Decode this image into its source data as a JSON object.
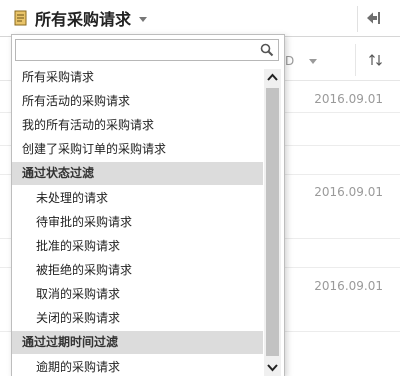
{
  "header": {
    "title": "所有采购请求",
    "icons": {
      "document": "document-icon",
      "back": "back-arrow-icon",
      "caret": "chevron-down-icon"
    }
  },
  "background": {
    "column_header": "D",
    "sort_icon": "sort-updown-icon",
    "rows": [
      {
        "date": "2016.09.01"
      },
      {
        "date": "2016.09.01"
      },
      {
        "date": "2016.09.01"
      }
    ]
  },
  "dropdown": {
    "search_value": "",
    "search_icon": "search-icon",
    "items": [
      {
        "label": "所有采购请求"
      },
      {
        "label": "所有活动的采购请求"
      },
      {
        "label": "我的所有活动的采购请求"
      },
      {
        "label": "创建了采购订单的采购请求"
      }
    ],
    "groups": [
      {
        "title": "通过状态过滤",
        "items": [
          {
            "label": "未处理的请求"
          },
          {
            "label": "待审批的采购请求"
          },
          {
            "label": "批准的采购请求"
          },
          {
            "label": "被拒绝的采购请求"
          },
          {
            "label": "取消的采购请求"
          },
          {
            "label": "关闭的采购请求"
          }
        ]
      },
      {
        "title": "通过过期时间过滤",
        "items": [
          {
            "label": "逾期的采购请求"
          }
        ]
      }
    ],
    "scroll_icons": {
      "up": "chevron-up-icon",
      "down": "chevron-down-icon"
    }
  },
  "colors": {
    "group_bg": "#dcdcdc",
    "scroll_thumb": "#c2c2c2",
    "date_text": "#9a9a9a"
  }
}
